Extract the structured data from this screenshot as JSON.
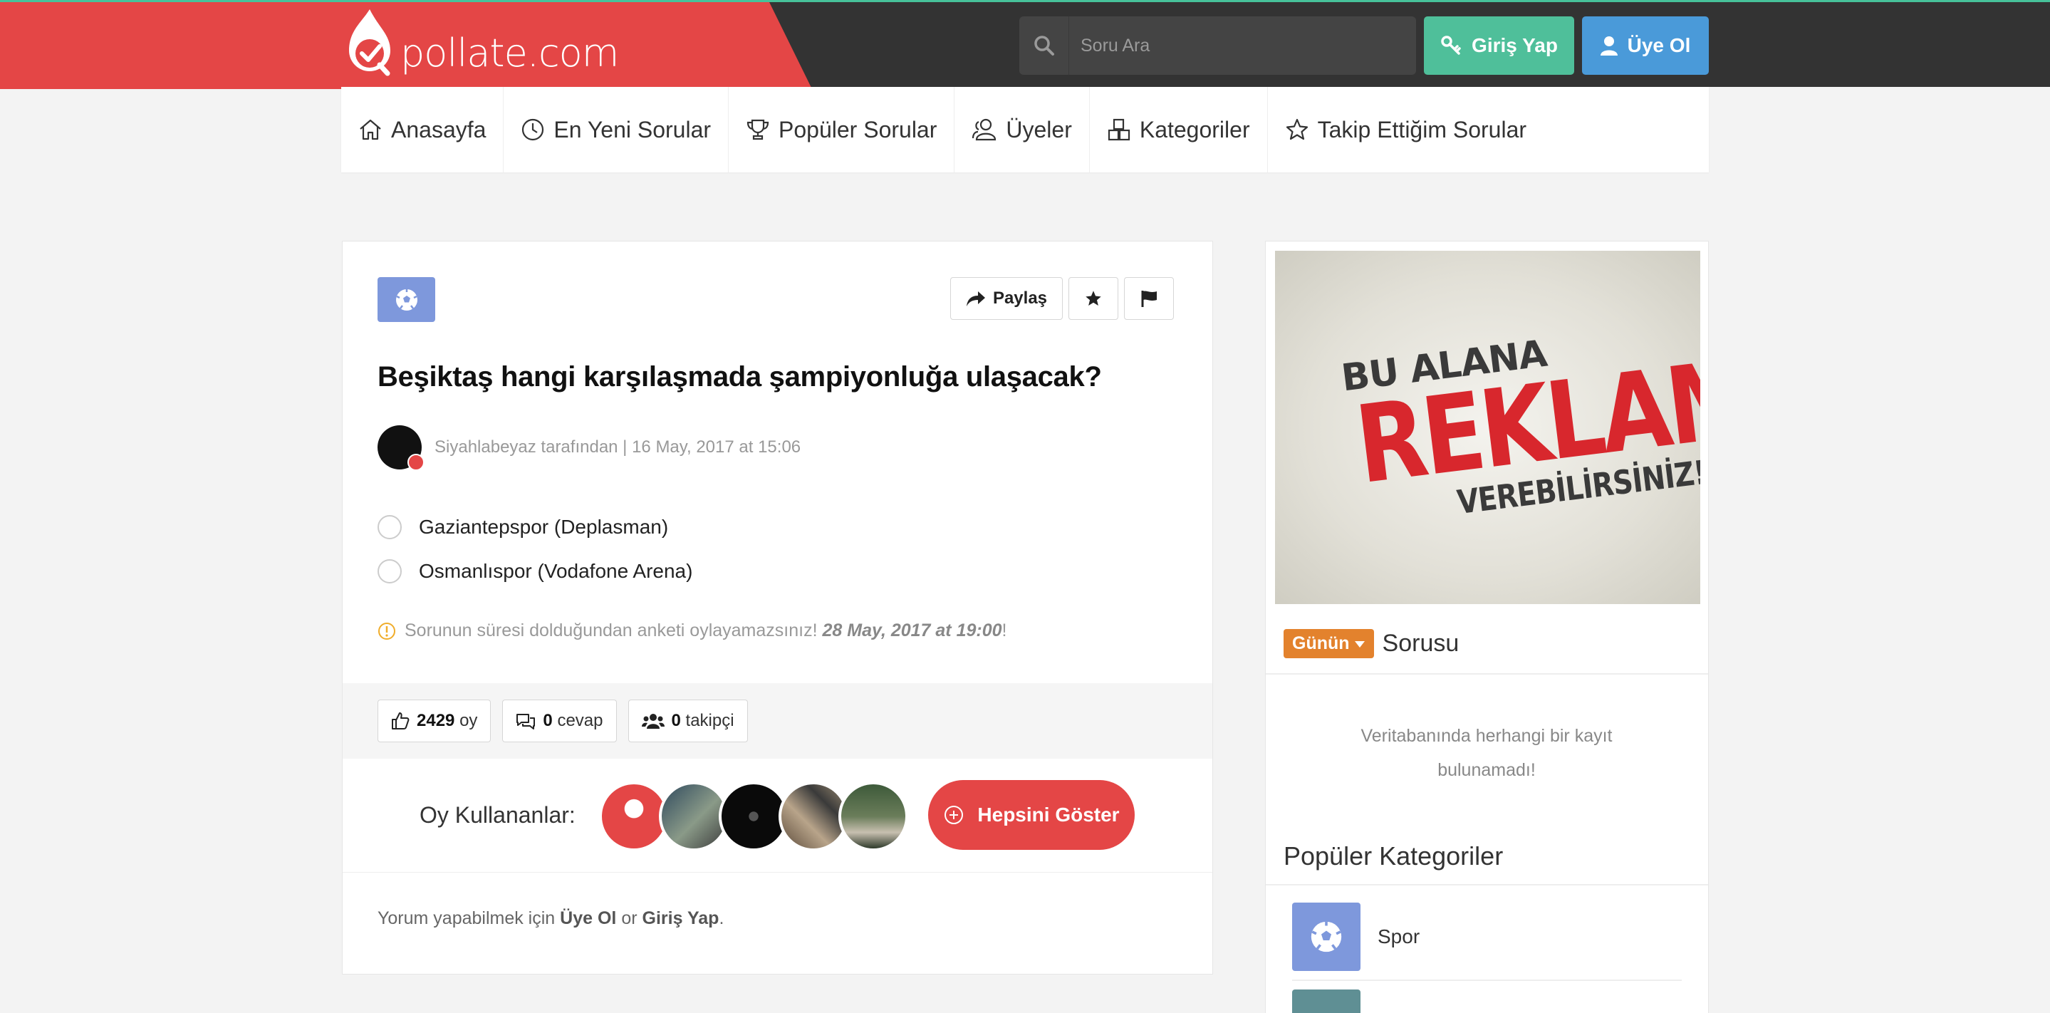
{
  "header": {
    "logo_text": "pollate.com",
    "search_placeholder": "Soru Ara",
    "login_label": "Giriş Yap",
    "signup_label": "Üye Ol",
    "colors": {
      "brand_red": "#e44646",
      "dark": "#333333",
      "green": "#4fbf9a",
      "blue": "#4a9ad9"
    }
  },
  "nav": {
    "items": [
      {
        "label": "Anasayfa",
        "icon": "home-icon"
      },
      {
        "label": "En Yeni Sorular",
        "icon": "clock-icon"
      },
      {
        "label": "Popüler Sorular",
        "icon": "trophy-icon"
      },
      {
        "label": "Üyeler",
        "icon": "users-icon"
      },
      {
        "label": "Kategoriler",
        "icon": "categories-icon"
      },
      {
        "label": "Takip Ettiğim Sorular",
        "icon": "star-icon"
      }
    ]
  },
  "question": {
    "category_icon": "soccer-ball-icon",
    "share_label": "Paylaş",
    "title": "Beşiktaş hangi karşılaşmada şampiyonluğa ulaşacak?",
    "author_line": "Siyahlabeyaz tarafından | 16 May, 2017 at 15:06",
    "options": [
      {
        "label": "Gaziantepspor (Deplasman)"
      },
      {
        "label": "Osmanlıspor (Vodafone Arena)"
      }
    ],
    "notice_text": "Sorunun süresi dolduğundan anketi oylayamazsınız!",
    "notice_date": "28 May, 2017 at 19:00",
    "notice_suffix": "!",
    "stats": {
      "votes_count": "2429",
      "votes_label": "oy",
      "answers_count": "0",
      "answers_label": "cevap",
      "followers_count": "0",
      "followers_label": "takipçi"
    },
    "voters_label": "Oy Kullananlar:",
    "show_all_label": "Hepsini Göster",
    "comment_prefix": "Yorum yapabilmek için",
    "comment_signup": "Üye Ol",
    "comment_or": "or",
    "comment_login": "Giriş Yap",
    "comment_suffix": "."
  },
  "sidebar": {
    "ad_line1": "BU ALANA",
    "ad_line2": "REKLAM",
    "ad_line3": "VEREBİLİRSİNİZ!",
    "sotd_tag": "Günün",
    "sotd_title": "Sorusu",
    "empty_message": "Veritabanında herhangi bir kayıt bulunamadı!",
    "popular_categories_title": "Popüler Kategoriler",
    "categories": [
      {
        "label": "Spor",
        "icon": "soccer-ball-icon"
      }
    ]
  }
}
